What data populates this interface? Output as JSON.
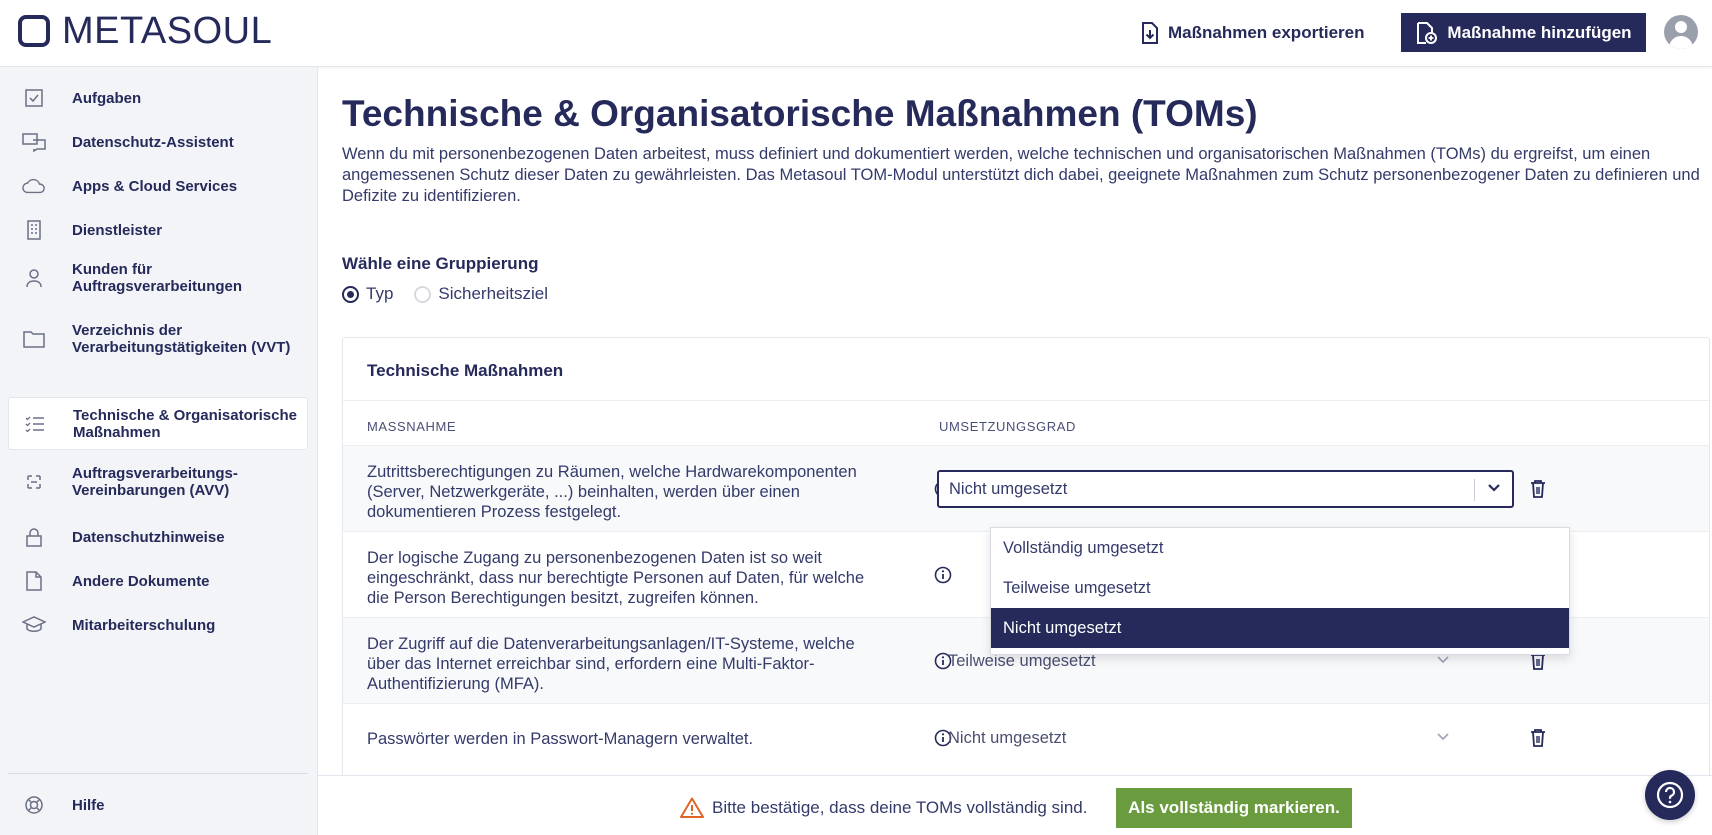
{
  "brand": {
    "name": "METASOUL"
  },
  "topbar": {
    "export_label": "Maßnahmen exportieren",
    "add_label": "Maßnahme hinzufügen"
  },
  "sidebar": {
    "items": [
      {
        "label": "Aufgaben",
        "icon": "checkbox-icon"
      },
      {
        "label": "Datenschutz-Assistent",
        "icon": "assistant-icon"
      },
      {
        "label": "Apps & Cloud Services",
        "icon": "cloud-icon"
      },
      {
        "label": "Dienstleister",
        "icon": "building-icon"
      },
      {
        "label": "Kunden für\nAuftragsverarbeitungen",
        "icon": "person-icon"
      },
      {
        "label": "Verzeichnis der\nVerarbeitungstätigkeiten (VVT)",
        "icon": "folder-icon"
      },
      {
        "label": "Technische & Organisatorische\nMaßnahmen",
        "icon": "checklist-icon",
        "active": true
      },
      {
        "label": "Auftragsverarbeitungs-\nVereinbarungen (AVV)",
        "icon": "contract-icon"
      },
      {
        "label": "Datenschutzhinweise",
        "icon": "lock-icon"
      },
      {
        "label": "Andere Dokumente",
        "icon": "document-icon"
      },
      {
        "label": "Mitarbeiterschulung",
        "icon": "graduation-cap-icon"
      }
    ],
    "help_label": "Hilfe"
  },
  "page": {
    "title": "Technische & Organisatorische Maßnahmen (TOMs)",
    "description": "Wenn du mit personenbezogenen Daten arbeitest, muss definiert und dokumentiert werden, welche technischen und organisatorischen Maßnahmen (TOMs) du ergreifst, um einen angemessenen Schutz dieser Daten zu gewährleisten. Das Metasoul TOM-Modul unterstützt dich dabei, geeignete Maßnahmen zum Schutz personenbezogener Daten zu definieren und Defizite zu identifizieren.",
    "grouping_label": "Wähle eine Gruppierung",
    "grouping_options": [
      "Typ",
      "Sicherheitsziel"
    ],
    "grouping_selected": "Typ"
  },
  "card": {
    "title": "Technische Maßnahmen",
    "col_measure": "MASSNAHME",
    "col_status": "UMSETZUNGSGRAD",
    "rows": [
      {
        "text": "Zutrittsberechtigungen zu Räumen, welche Hardwarekomponenten (Server, Netzwerkgeräte, ...) beinhalten, werden über einen dokumentieren Prozess festgelegt.",
        "status": "Nicht umgesetzt",
        "open": true
      },
      {
        "text": "Der logische Zugang zu personenbezogenen Daten ist so weit eingeschränkt, dass nur berechtigte Personen auf Daten, für welche die Person Berechtigungen besitzt, zugreifen können.",
        "status": ""
      },
      {
        "text": "Der Zugriff auf die Datenverarbeitungsanlagen/IT-Systeme, welche über das Internet erreichbar sind, erfordern eine Multi-Faktor-Authentifizierung (MFA).",
        "status": "Teilweise umgesetzt"
      },
      {
        "text": "Passwörter werden in Passwort-Managern verwaltet.",
        "status": "Nicht umgesetzt"
      }
    ]
  },
  "dropdown": {
    "options": [
      "Vollständig umgesetzt",
      "Teilweise umgesetzt",
      "Nicht umgesetzt"
    ],
    "selected": "Nicht umgesetzt"
  },
  "bottombar": {
    "warning_text": "Bitte bestätige, dass deine TOMs vollständig sind.",
    "confirm_label": "Als vollständig markieren."
  },
  "colors": {
    "primary": "#262a5a",
    "success": "#6a9c3f",
    "warning": "#e0632a",
    "sidebar_bg": "#f2f4f7"
  }
}
